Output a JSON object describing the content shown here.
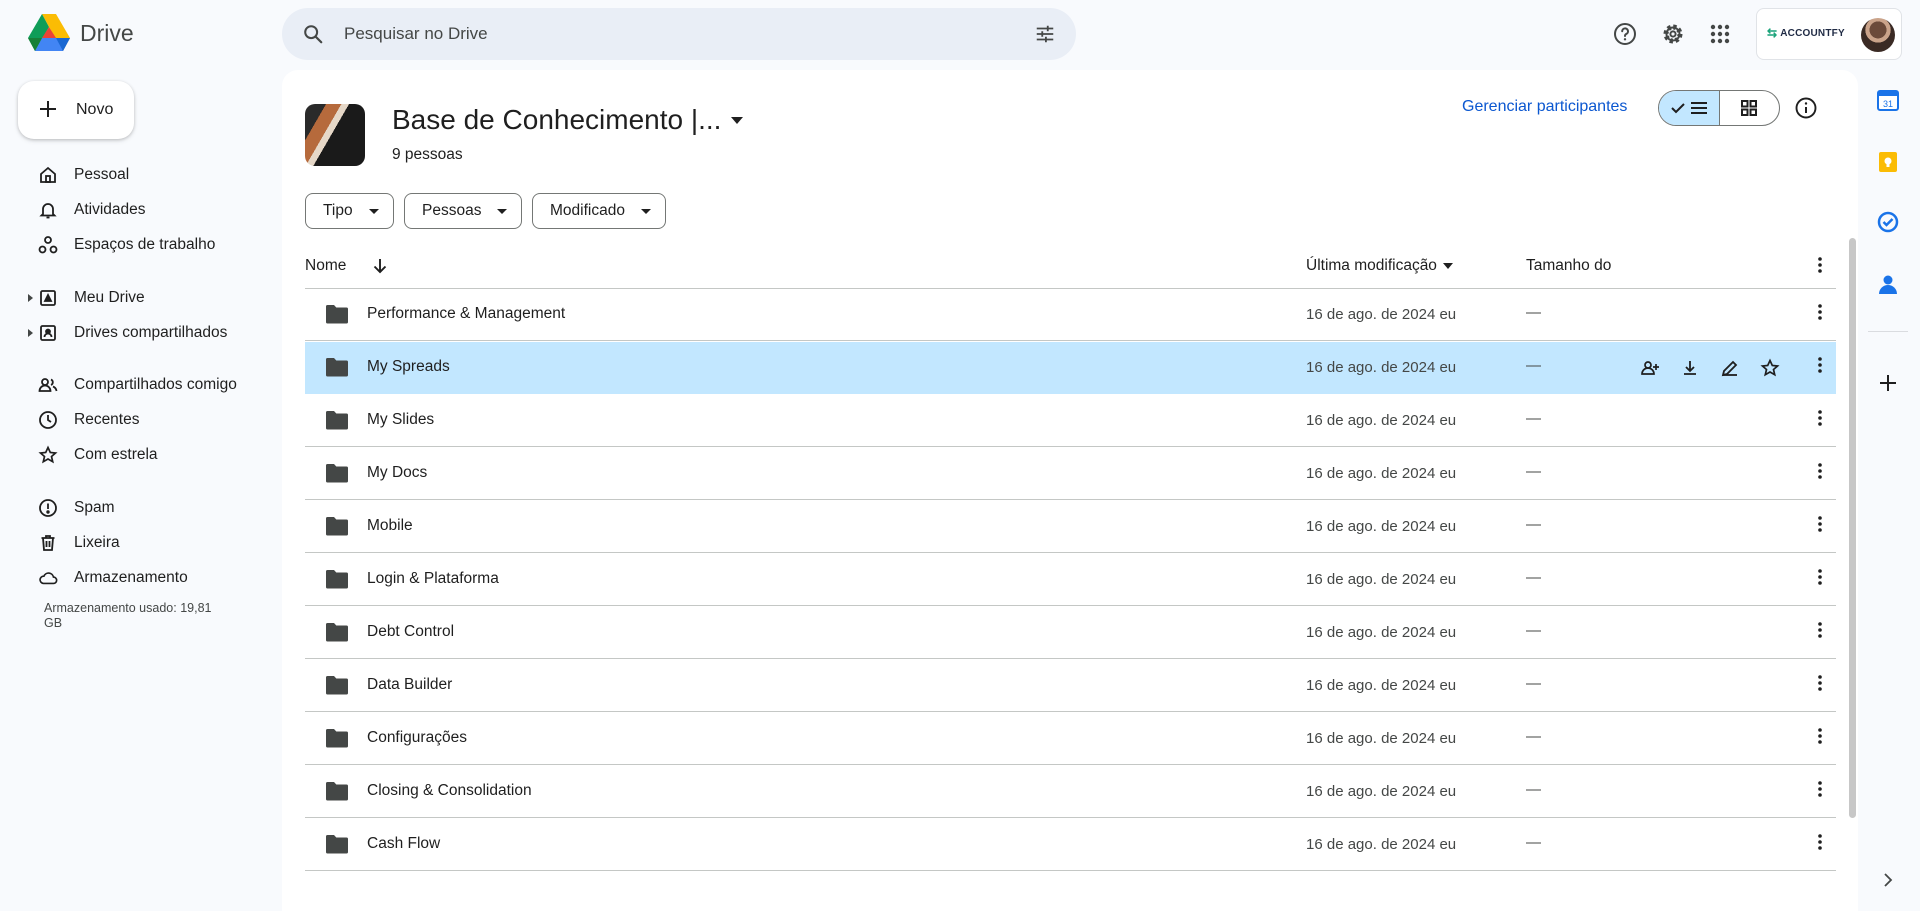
{
  "app": {
    "name": "Drive"
  },
  "search": {
    "placeholder": "Pesquisar no Drive"
  },
  "account": {
    "brand": "ACCOUNTFY"
  },
  "sidebar": {
    "new_label": "Novo",
    "items": [
      {
        "label": "Pessoal",
        "icon": "home-icon"
      },
      {
        "label": "Atividades",
        "icon": "bell-icon"
      },
      {
        "label": "Espaços de trabalho",
        "icon": "workspaces-icon"
      },
      {
        "label": "Meu Drive",
        "icon": "my-drive-icon"
      },
      {
        "label": "Drives compartilhados",
        "icon": "shared-drives-icon"
      },
      {
        "label": "Compartilhados comigo",
        "icon": "people-icon"
      },
      {
        "label": "Recentes",
        "icon": "clock-icon"
      },
      {
        "label": "Com estrela",
        "icon": "star-icon"
      },
      {
        "label": "Spam",
        "icon": "spam-icon"
      },
      {
        "label": "Lixeira",
        "icon": "trash-icon"
      },
      {
        "label": "Armazenamento",
        "icon": "cloud-icon"
      }
    ],
    "storage_text": "Armazenamento usado: 19,81 GB"
  },
  "header": {
    "title": "Base de Conhecimento |...",
    "people": "9 pessoas",
    "manage_label": "Gerenciar participantes"
  },
  "filters": {
    "tipo": "Tipo",
    "pessoas": "Pessoas",
    "modificado": "Modificado"
  },
  "table": {
    "col_name": "Nome",
    "col_modified": "Última modificação",
    "col_size": "Tamanho do",
    "rows": [
      {
        "name": "Performance & Management",
        "modified": "16 de ago. de 2024 eu",
        "size": "—"
      },
      {
        "name": "My Spreads",
        "modified": "16 de ago. de 2024 eu",
        "size": "—"
      },
      {
        "name": "My Slides",
        "modified": "16 de ago. de 2024 eu",
        "size": "—"
      },
      {
        "name": "My Docs",
        "modified": "16 de ago. de 2024 eu",
        "size": "—"
      },
      {
        "name": "Mobile",
        "modified": "16 de ago. de 2024 eu",
        "size": "—"
      },
      {
        "name": "Login & Plataforma",
        "modified": "16 de ago. de 2024 eu",
        "size": "—"
      },
      {
        "name": "Debt Control",
        "modified": "16 de ago. de 2024 eu",
        "size": "—"
      },
      {
        "name": "Data Builder",
        "modified": "16 de ago. de 2024 eu",
        "size": "—"
      },
      {
        "name": "Configurações",
        "modified": "16 de ago. de 2024 eu",
        "size": "—"
      },
      {
        "name": "Closing & Consolidation",
        "modified": "16 de ago. de 2024 eu",
        "size": "—"
      },
      {
        "name": "Cash Flow",
        "modified": "16 de ago. de 2024 eu",
        "size": "—"
      }
    ],
    "selected_index": 1
  },
  "colors": {
    "accent": "#0b57d0",
    "selected": "#c2e7ff",
    "background": "#f8fafd"
  }
}
